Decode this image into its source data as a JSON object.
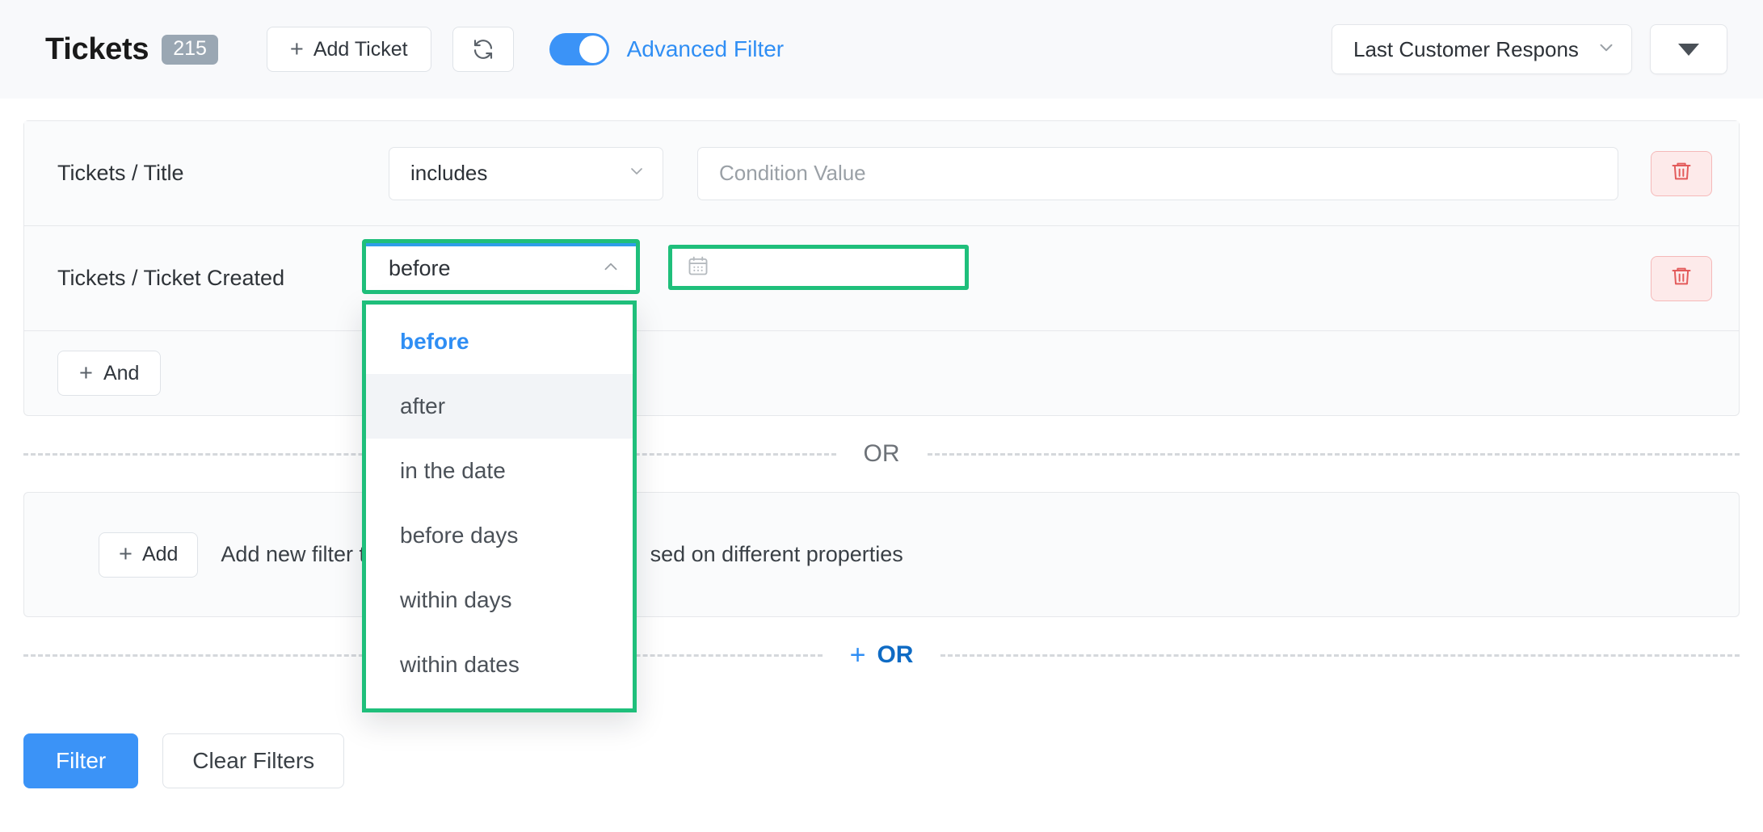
{
  "header": {
    "title": "Tickets",
    "count_badge": "215",
    "add_ticket_label": "Add Ticket",
    "add_ticket_plus": "+",
    "refresh_icon": "refresh-icon",
    "advanced_filter_label": "Advanced Filter",
    "advanced_filter_on": true,
    "view_select_value": "Last Customer Respons",
    "view_caret_label": "",
    "accent_blue": "#3b93f7",
    "badge_color": "#9aa7b3"
  },
  "filter_group": {
    "rows": [
      {
        "field": "Tickets / Title",
        "operator": "includes",
        "value": "",
        "value_placeholder": "Condition Value",
        "delete_icon": "trash-icon"
      },
      {
        "field": "Tickets / Ticket Created",
        "operator": "before",
        "value": "",
        "value_placeholder": "",
        "date_icon": "calendar-icon",
        "delete_icon": "trash-icon"
      }
    ],
    "and_button_label": "And",
    "and_button_plus": "+"
  },
  "operator_dropdown": {
    "open": true,
    "selected": "before",
    "hovered": "after",
    "options": [
      "before",
      "after",
      "in the date",
      "before days",
      "within days",
      "within dates"
    ]
  },
  "dividers": {
    "or_label": "OR",
    "or_add_label": "OR",
    "or_add_plus": "+"
  },
  "add_panel": {
    "add_button_label": "Add",
    "add_button_plus": "+",
    "hint_prefix": "Add new filter to na",
    "hint_suffix": "sed on different properties"
  },
  "footer": {
    "filter_label": "Filter",
    "clear_label": "Clear Filters"
  },
  "colors": {
    "highlight_green": "#1fbf7b",
    "link_blue": "#2f8ef4",
    "danger_red": "#e35b5b"
  }
}
